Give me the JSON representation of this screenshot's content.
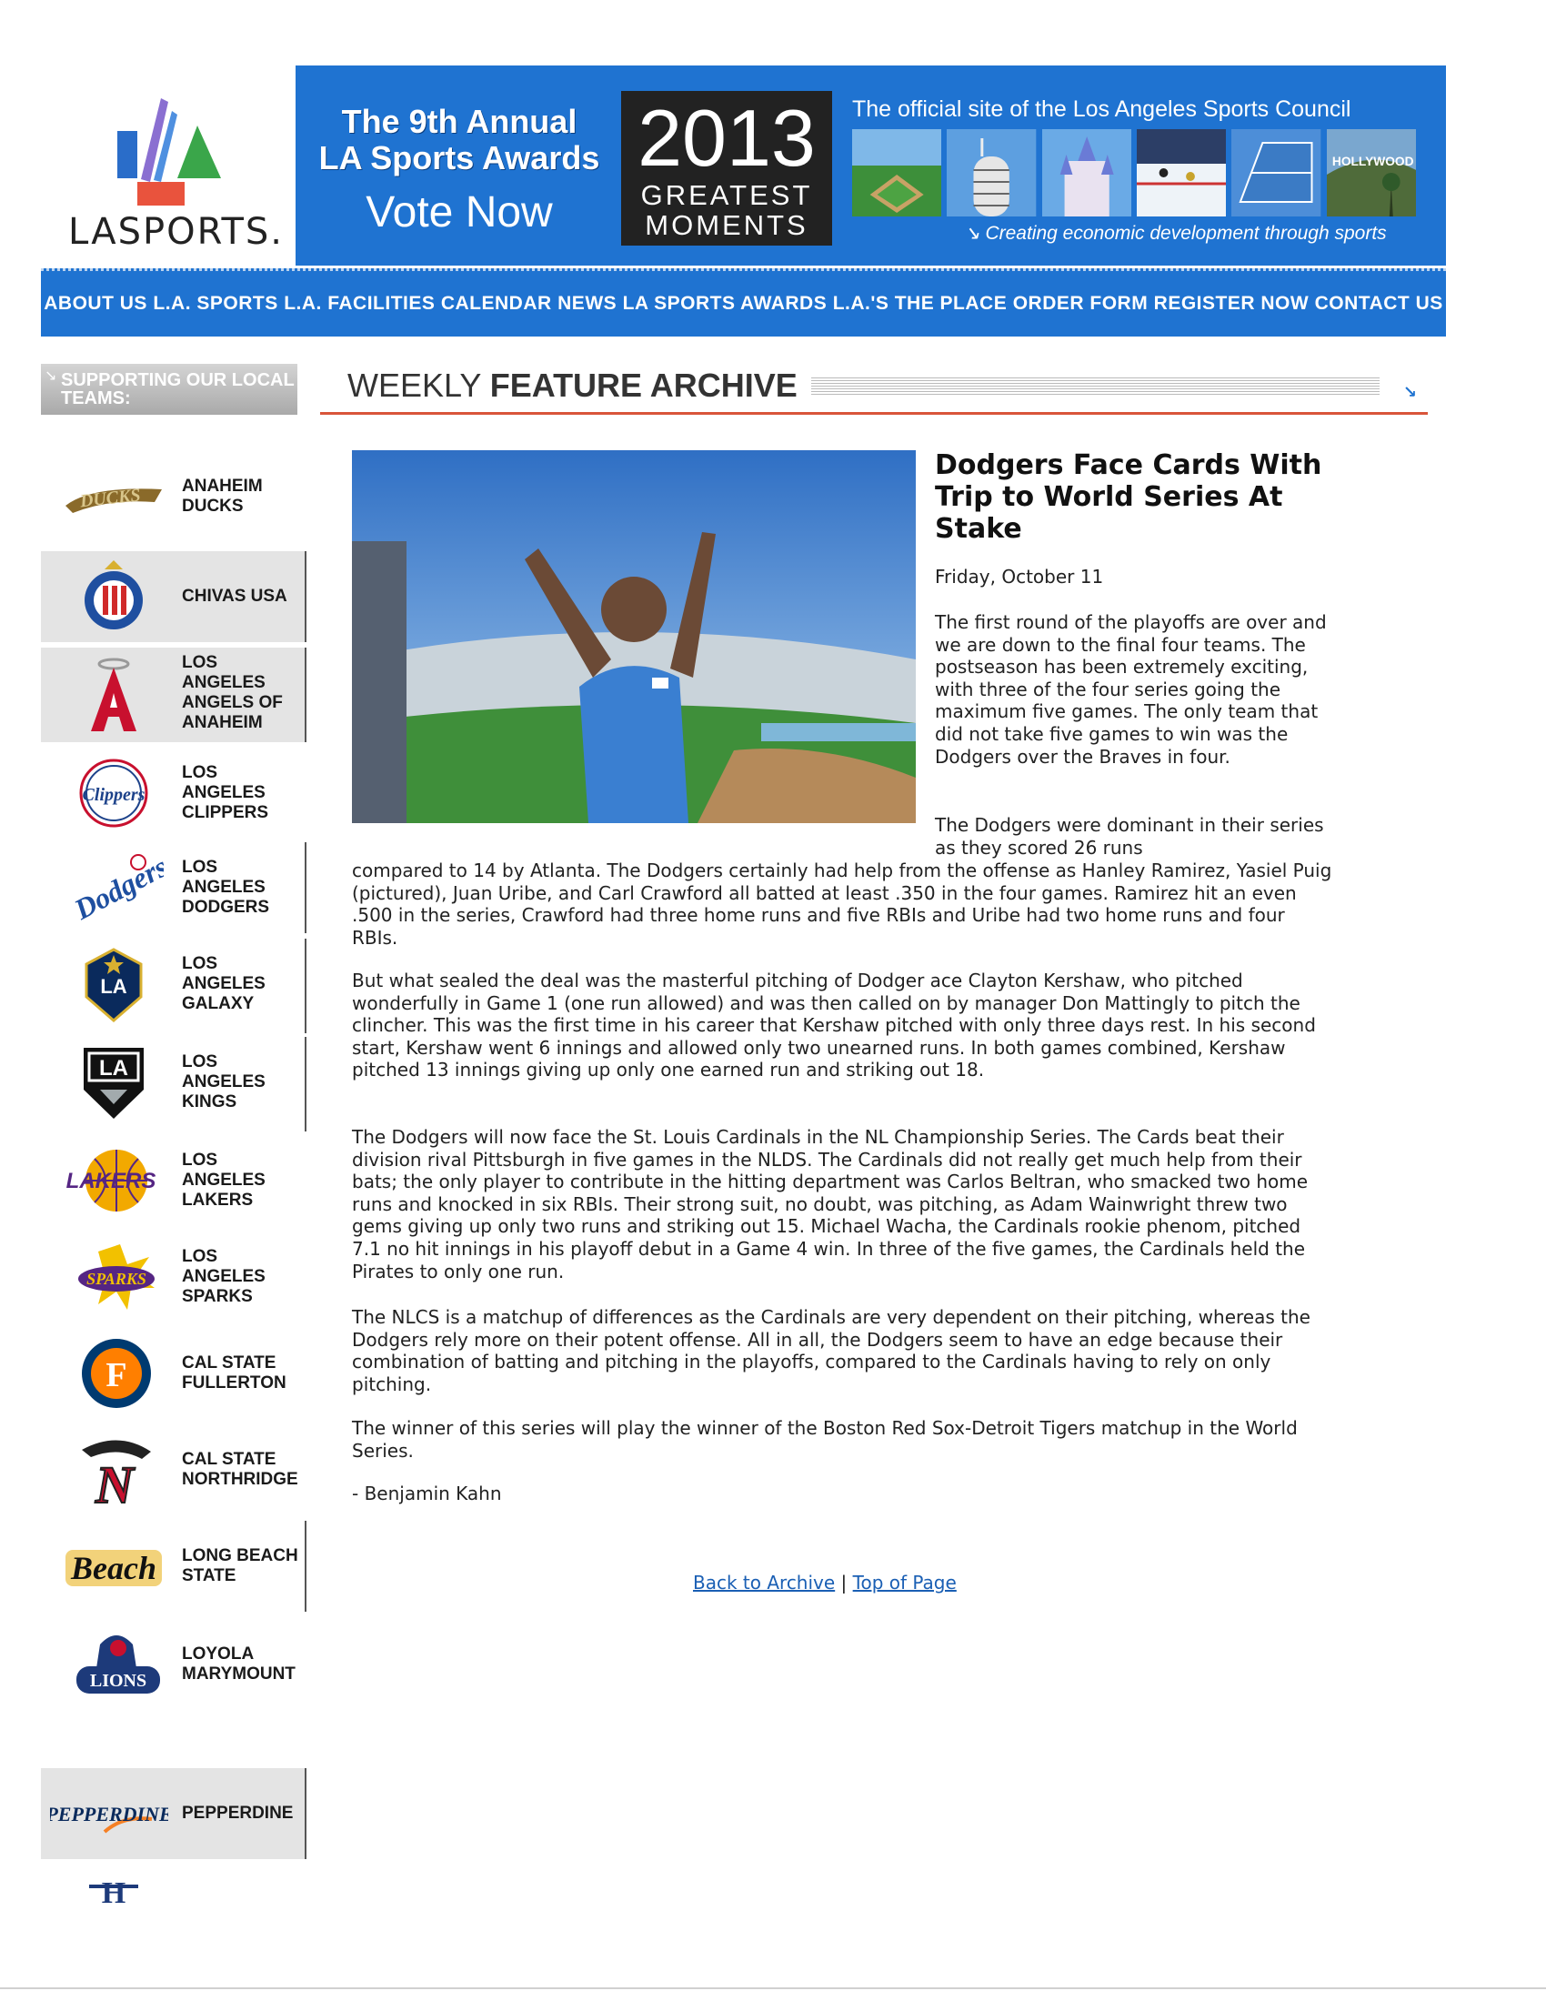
{
  "header": {
    "logo_text": "LASPORTS.",
    "award_line1": "The 9th Annual",
    "award_line2": "LA Sports Awards",
    "vote": "Vote Now",
    "year": "2013",
    "greatest": "GREATEST",
    "moments": "MOMENTS",
    "official": "The official site of the Los Angeles Sports Council",
    "tagline": "Creating economic development through sports",
    "brand_color": "#1f73d1"
  },
  "nav": {
    "items": [
      "ABOUT US",
      "L.A. SPORTS",
      "L.A. FACILITIES",
      "CALENDAR",
      "NEWS",
      "LA SPORTS AWARDS",
      "L.A.'S THE PLACE",
      "ORDER FORM",
      "REGISTER NOW",
      "CONTACT US"
    ]
  },
  "sidebar": {
    "heading": "SUPPORTING OUR LOCAL TEAMS:",
    "teams": [
      {
        "name": "ANAHEIM DUCKS",
        "icon": "ducks-logo"
      },
      {
        "name": "CHIVAS USA",
        "icon": "chivas-logo"
      },
      {
        "name": "LOS ANGELES ANGELS OF ANAHEIM",
        "icon": "angels-logo"
      },
      {
        "name": "LOS ANGELES CLIPPERS",
        "icon": "clippers-logo"
      },
      {
        "name": "LOS ANGELES DODGERS",
        "icon": "dodgers-logo"
      },
      {
        "name": "LOS ANGELES GALAXY",
        "icon": "galaxy-logo"
      },
      {
        "name": "LOS ANGELES KINGS",
        "icon": "kings-logo"
      },
      {
        "name": "LOS ANGELES LAKERS",
        "icon": "lakers-logo"
      },
      {
        "name": "LOS ANGELES SPARKS",
        "icon": "sparks-logo"
      },
      {
        "name": "CAL STATE FULLERTON",
        "icon": "fullerton-logo"
      },
      {
        "name": "CAL STATE NORTHRIDGE",
        "icon": "northridge-logo"
      },
      {
        "name": "LONG BEACH STATE",
        "icon": "beach-logo"
      },
      {
        "name": "LOYOLA MARYMOUNT",
        "icon": "lions-logo"
      },
      {
        "name": "PEPPERDINE",
        "icon": "pepperdine-logo"
      }
    ]
  },
  "feature": {
    "title_light": "WEEKLY ",
    "title_bold": "FEATURE ARCHIVE"
  },
  "article": {
    "headline": "Dodgers Face Cards With Trip to World Series At Stake",
    "date": "Friday, October 11",
    "p1": "The first round of the playoffs are over and we are down to the final four teams. The postseason has been extremely exciting, with three of the four series going the maximum five games. The only team that did not take five games to win was the Dodgers over the Braves in four.",
    "p2a": "The Dodgers were dominant in their series as they scored 26 runs",
    "p2b": "compared to 14 by Atlanta. The Dodgers certainly had help from the offense as Hanley Ramirez, Yasiel Puig (pictured), Juan Uribe, and Carl Crawford all batted at least .350 in the four games. Ramirez hit an even .500 in the series, Crawford had three home runs and five RBIs and Uribe had two home runs and four RBIs.",
    "p3": "But what sealed the deal was the masterful pitching of Dodger ace Clayton Kershaw, who pitched wonderfully in Game 1 (one run allowed) and was then called on by manager Don Mattingly to pitch the clincher. This was the first time in his career that Kershaw pitched with only three days rest. In his second start, Kershaw went 6 innings and allowed only two unearned runs. In both games combined, Kershaw pitched 13 innings giving up only one earned run and striking out 18.",
    "p4": "The Dodgers will now face the St. Louis Cardinals in the NL Championship Series. The Cards beat their division rival Pittsburgh in five games in the NLDS. The Cardinals did not really get much help from their bats; the only player to contribute in the hitting department was Carlos Beltran, who smacked two home runs and knocked in six RBIs. Their strong suit, no doubt, was pitching, as Adam Wainwright threw two gems giving up only two runs and striking out 15. Michael Wacha, the Cardinals rookie phenom, pitched 7.1 no hit innings in his playoff debut in a Game 4 win. In three of the five games, the Cardinals held the Pirates to only one run.",
    "p5": "The NLCS is a matchup of differences as the Cardinals are very dependent on their pitching, whereas the Dodgers rely more on their potent offense. All in all, the Dodgers seem to have an edge because their combination of batting and pitching in the playoffs, compared to the Cardinals having to rely on only pitching.",
    "p6": "The winner of this series will play the winner of the Boston Red Sox-Detroit Tigers matchup in the World Series.",
    "byline": "- Benjamin Kahn"
  },
  "links": {
    "back": "Back to Archive",
    "separator": " | ",
    "top": "Top of Page"
  }
}
